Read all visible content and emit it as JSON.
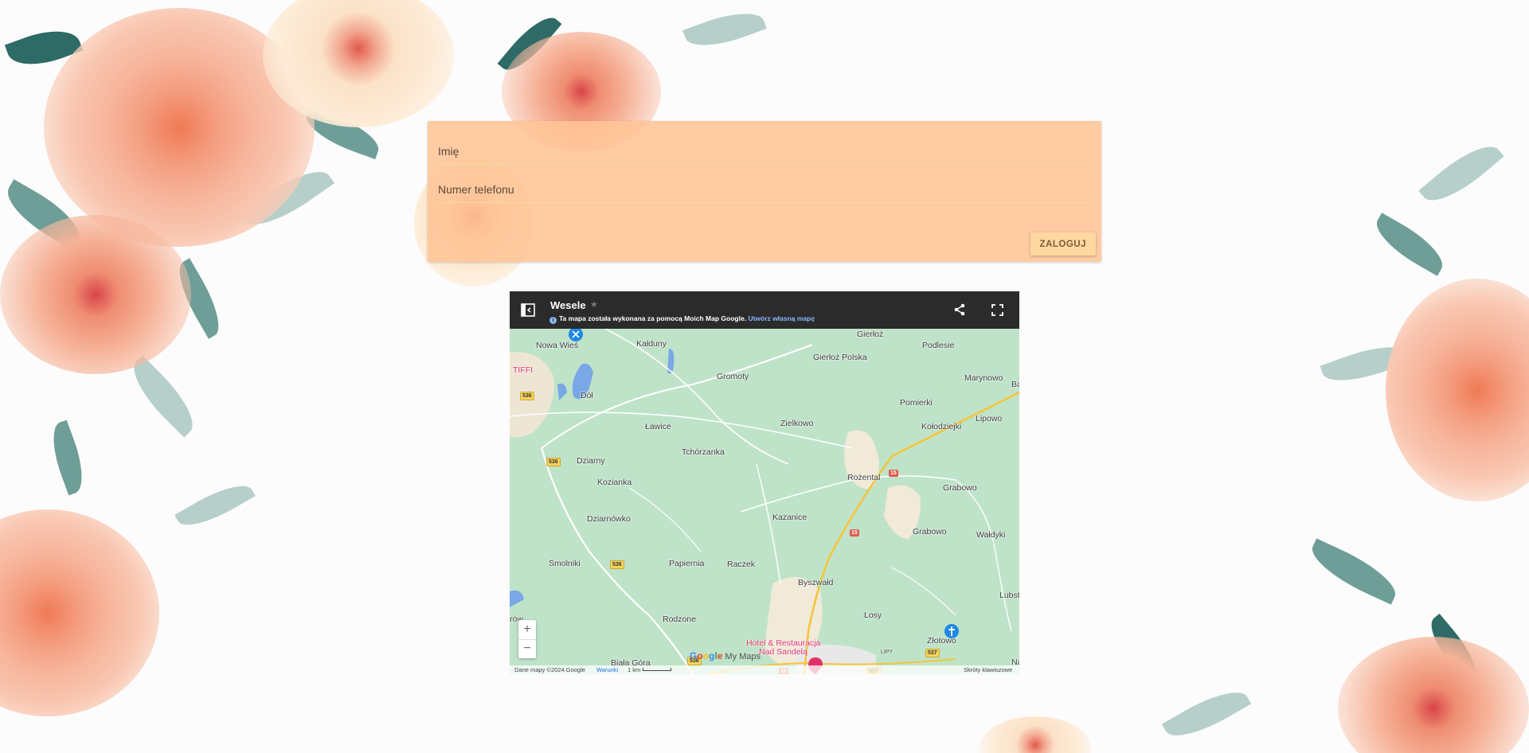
{
  "login": {
    "name_placeholder": "Imię",
    "phone_placeholder": "Numer telefonu",
    "login_button": "ZALOGUJ"
  },
  "map": {
    "title": "Wesele",
    "subtitle": "Ta mapa została wykonana za pomocą Moich Map Google.",
    "create_link": "Utwórz własną mapę",
    "zoom_in": "+",
    "zoom_out": "−",
    "logo_letters": [
      "G",
      "o",
      "o",
      "g",
      "l",
      "e"
    ],
    "logo_suffix": "My Maps",
    "footer": {
      "data": "Dane mapy ©2024 Google",
      "terms": "Warunki",
      "scale": "1 km",
      "shortcuts": "Skróty klawiszowe"
    },
    "places": {
      "nowa_wies": "Nowa Wieś",
      "kaldany": "Kałduny",
      "gromoty": "Gromoty",
      "gierloz": "Gierłoż",
      "gierloz_polska": "Gierłoż Polska",
      "podlesie": "Podlesie",
      "marynowo": "Marynowo",
      "b": "Ba",
      "tiffi": "TIFFI",
      "dol": "Dół",
      "pomierki": "Pomierki",
      "lawice": "Ławice",
      "zielkowo": "Zielkowo",
      "kolodziejki": "Kołodziejki",
      "lipowo": "Lipowo",
      "tchorzanka": "Tchórzanka",
      "dziarny": "Dziarny",
      "kozianka": "Kozianka",
      "rozental": "Rożental",
      "grabowo1": "Grabowo",
      "dziarnowko": "Dziarnówko",
      "kazanice": "Kazanice",
      "grabowo2": "Grabowo",
      "waldyki": "Wałdyki",
      "smolniki": "Smolniki",
      "papiernia": "Papiernia",
      "raczek": "Raczek",
      "byszwald": "Byszwałd",
      "lubsty": "Lubsty",
      "row": "rów",
      "rodzone": "Rodzone",
      "losy": "Losy",
      "hotel": "Hotel & Restauracja",
      "hotel2": "Nad Sandelą",
      "zlotowo": "Złotowo",
      "lipy": "LIPY",
      "na": "Na",
      "biala_gora": "Biała Góra"
    },
    "routes": {
      "r536a": "536",
      "r536b": "536",
      "r536c": "536",
      "r536d": "536",
      "r15a": "15",
      "r15b": "15",
      "r15c": "15",
      "r537a": "537",
      "r537b": "537"
    }
  },
  "colors": {
    "card": "#ffc496",
    "button": "#ffd8a0",
    "map_header": "#2b2b2b",
    "map_land": "#bfe3c8"
  }
}
